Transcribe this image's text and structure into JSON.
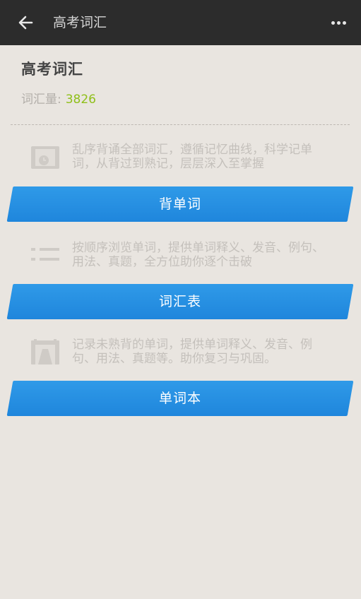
{
  "topbar": {
    "title": "高考词汇",
    "back_icon": "back-arrow-icon",
    "more_icon": "more-dots-icon"
  },
  "header": {
    "title": "高考词汇",
    "count_label": "词汇量:",
    "count_value": "3826"
  },
  "sections": [
    {
      "icon": "calendar-clock-icon",
      "description": "乱序背诵全部词汇，遵循记忆曲线，科学记单词，从背过到熟记，层层深入至掌握",
      "button_label": "背单词"
    },
    {
      "icon": "list-icon",
      "description": "按顺序浏览单词，提供单词释义、发音、例句、用法、真题，全方位助你逐个击破",
      "button_label": "词汇表"
    },
    {
      "icon": "notebook-icon",
      "description": "记录未熟背的单词，提供单词释义、发音、例句、用法、真题等。助你复习与巩固。",
      "button_label": "单词本"
    }
  ],
  "colors": {
    "topbar": "#2c2c2c",
    "background": "#e9e5e0",
    "button": "#2590e3",
    "count_value": "#8fbf1a"
  }
}
